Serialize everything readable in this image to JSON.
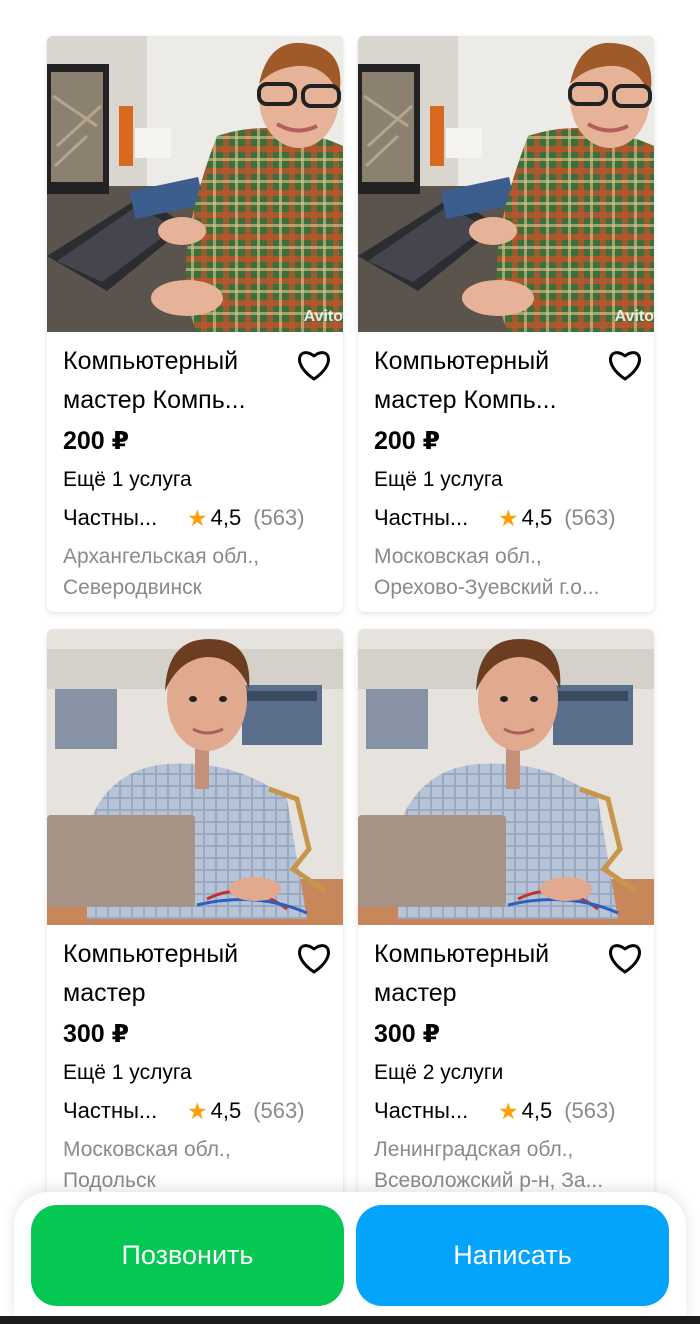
{
  "listings": [
    {
      "title": "Компьютерный мастер Компь...",
      "price": "200 ₽",
      "services": "Ещё 1 услуга",
      "seller": "Частны...",
      "rating": "4,5",
      "reviews": "(563)",
      "location_line1": "Архангельская обл.,",
      "location_line2": "Северодвинск",
      "watermark": "Avito"
    },
    {
      "title": "Компьютерный мастер Компь...",
      "price": "200 ₽",
      "services": "Ещё 1 услуга",
      "seller": "Частны...",
      "rating": "4,5",
      "reviews": "(563)",
      "location_line1": "Московская обл.,",
      "location_line2": "Орехово-Зуевский г.о...",
      "watermark": "Avito"
    },
    {
      "title": "Компьютерный мастер",
      "price": "300 ₽",
      "services": "Ещё 1 услуга",
      "seller": "Частны...",
      "rating": "4,5",
      "reviews": "(563)",
      "location_line1": "Московская обл.,",
      "location_line2": "Подольск"
    },
    {
      "title": "Компьютерный мастер",
      "price": "300 ₽",
      "services": "Ещё 2 услуги",
      "seller": "Частны...",
      "rating": "4,5",
      "reviews": "(563)",
      "location_line1": "Ленинградская обл.,",
      "location_line2": "Всеволожский р-н, За..."
    }
  ],
  "icons": {
    "favorite": "heart-outline-icon",
    "rating": "star-icon"
  },
  "actions": {
    "call_label": "Позвонить",
    "write_label": "Написать"
  },
  "colors": {
    "call": "#04c851",
    "write": "#04a4fc",
    "star": "#ff9f0a",
    "muted": "#8a8a8a"
  }
}
